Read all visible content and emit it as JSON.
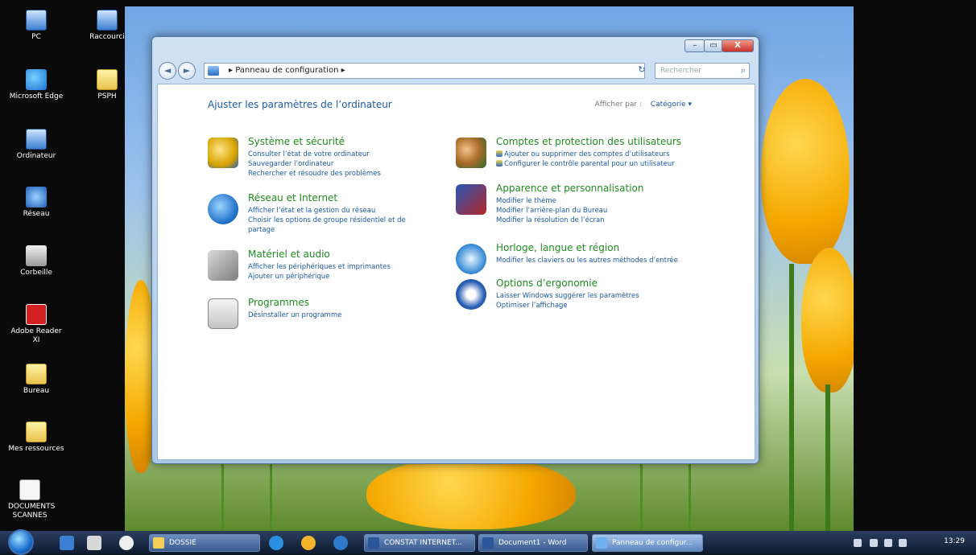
{
  "desktop": {
    "icons": [
      {
        "label": "PC",
        "icon": "computer-icon"
      },
      {
        "label": "Raccourci",
        "icon": "shortcut-icon"
      },
      {
        "label": "Microsoft Edge",
        "icon": "edge-icon"
      },
      {
        "label": "PSPH",
        "icon": "folder-icon"
      },
      {
        "label": "Ordinateur",
        "icon": "computer-icon"
      },
      {
        "label": "Réseau",
        "icon": "network-icon"
      },
      {
        "label": "Corbeille",
        "icon": "recycle-bin-icon"
      },
      {
        "label": "Adobe Reader XI",
        "icon": "pdf-icon"
      },
      {
        "label": "Bureau",
        "icon": "folder-icon"
      },
      {
        "label": "Mes ressources",
        "icon": "folder-icon"
      },
      {
        "label": "DOCUMENTS SCANNES",
        "icon": "document-icon"
      }
    ]
  },
  "window": {
    "title_buttons": {
      "minimize": "–",
      "maximize": "▭",
      "close": "X"
    },
    "nav": {
      "back": "◄",
      "forward": "►"
    },
    "address": {
      "path": "Panneau de configuration",
      "separator": "▸"
    },
    "refresh": "↻",
    "search": {
      "placeholder": "Rechercher",
      "icon": "search-icon"
    },
    "heading": "Ajuster les paramètres de l’ordinateur",
    "view_by": {
      "label": "Afficher par :",
      "value": "Catégorie"
    },
    "left_categories": [
      {
        "title": "Système et sécurité",
        "icon": "security-shield-icon",
        "links": [
          "Consulter l’état de votre ordinateur",
          "Sauvegarder l’ordinateur",
          "Rechercher et résoudre des problèmes"
        ]
      },
      {
        "title": "Réseau et Internet",
        "icon": "network-globe-icon",
        "links": [
          "Afficher l’état et la gestion du réseau",
          "Choisir les options de groupe résidentiel et de",
          "partage"
        ]
      },
      {
        "title": "Matériel et audio",
        "icon": "speaker-icon",
        "links": [
          "Afficher les périphériques et imprimantes",
          "Ajouter un périphérique"
        ]
      },
      {
        "title": "Programmes",
        "icon": "programs-icon",
        "links": [
          "Désinstaller un programme"
        ]
      }
    ],
    "right_categories": [
      {
        "title": "Comptes et protection des utilisateurs",
        "icon": "user-accounts-icon",
        "links": [
          "Ajouter ou supprimer des comptes d’utilisateurs",
          "Configurer le contrôle parental pour un utilisateur"
        ]
      },
      {
        "title": "Apparence et personnalisation",
        "icon": "appearance-icon",
        "links": [
          "Modifier le thème",
          "Modifier l’arrière-plan du Bureau",
          "Modifier la résolution de l’écran"
        ]
      },
      {
        "title": "Horloge, langue et région",
        "icon": "clock-globe-icon",
        "links": [
          "Modifier les claviers ou les autres méthodes d’entrée"
        ]
      },
      {
        "title": "Options d’ergonomie",
        "icon": "ease-of-access-icon",
        "links": [
          "Laisser Windows suggérer les paramètres",
          "Optimiser l’affichage"
        ]
      }
    ]
  },
  "taskbar": {
    "buttons": [
      {
        "label": "DOSSIE",
        "icon": "folder-icon"
      },
      {
        "label": "CONSTAT INTERNET...",
        "icon": "word-icon"
      },
      {
        "label": "Document1 - Word",
        "icon": "word-icon"
      },
      {
        "label": "Panneau de configur...",
        "icon": "control-panel-icon"
      }
    ],
    "clock": "13:29"
  }
}
